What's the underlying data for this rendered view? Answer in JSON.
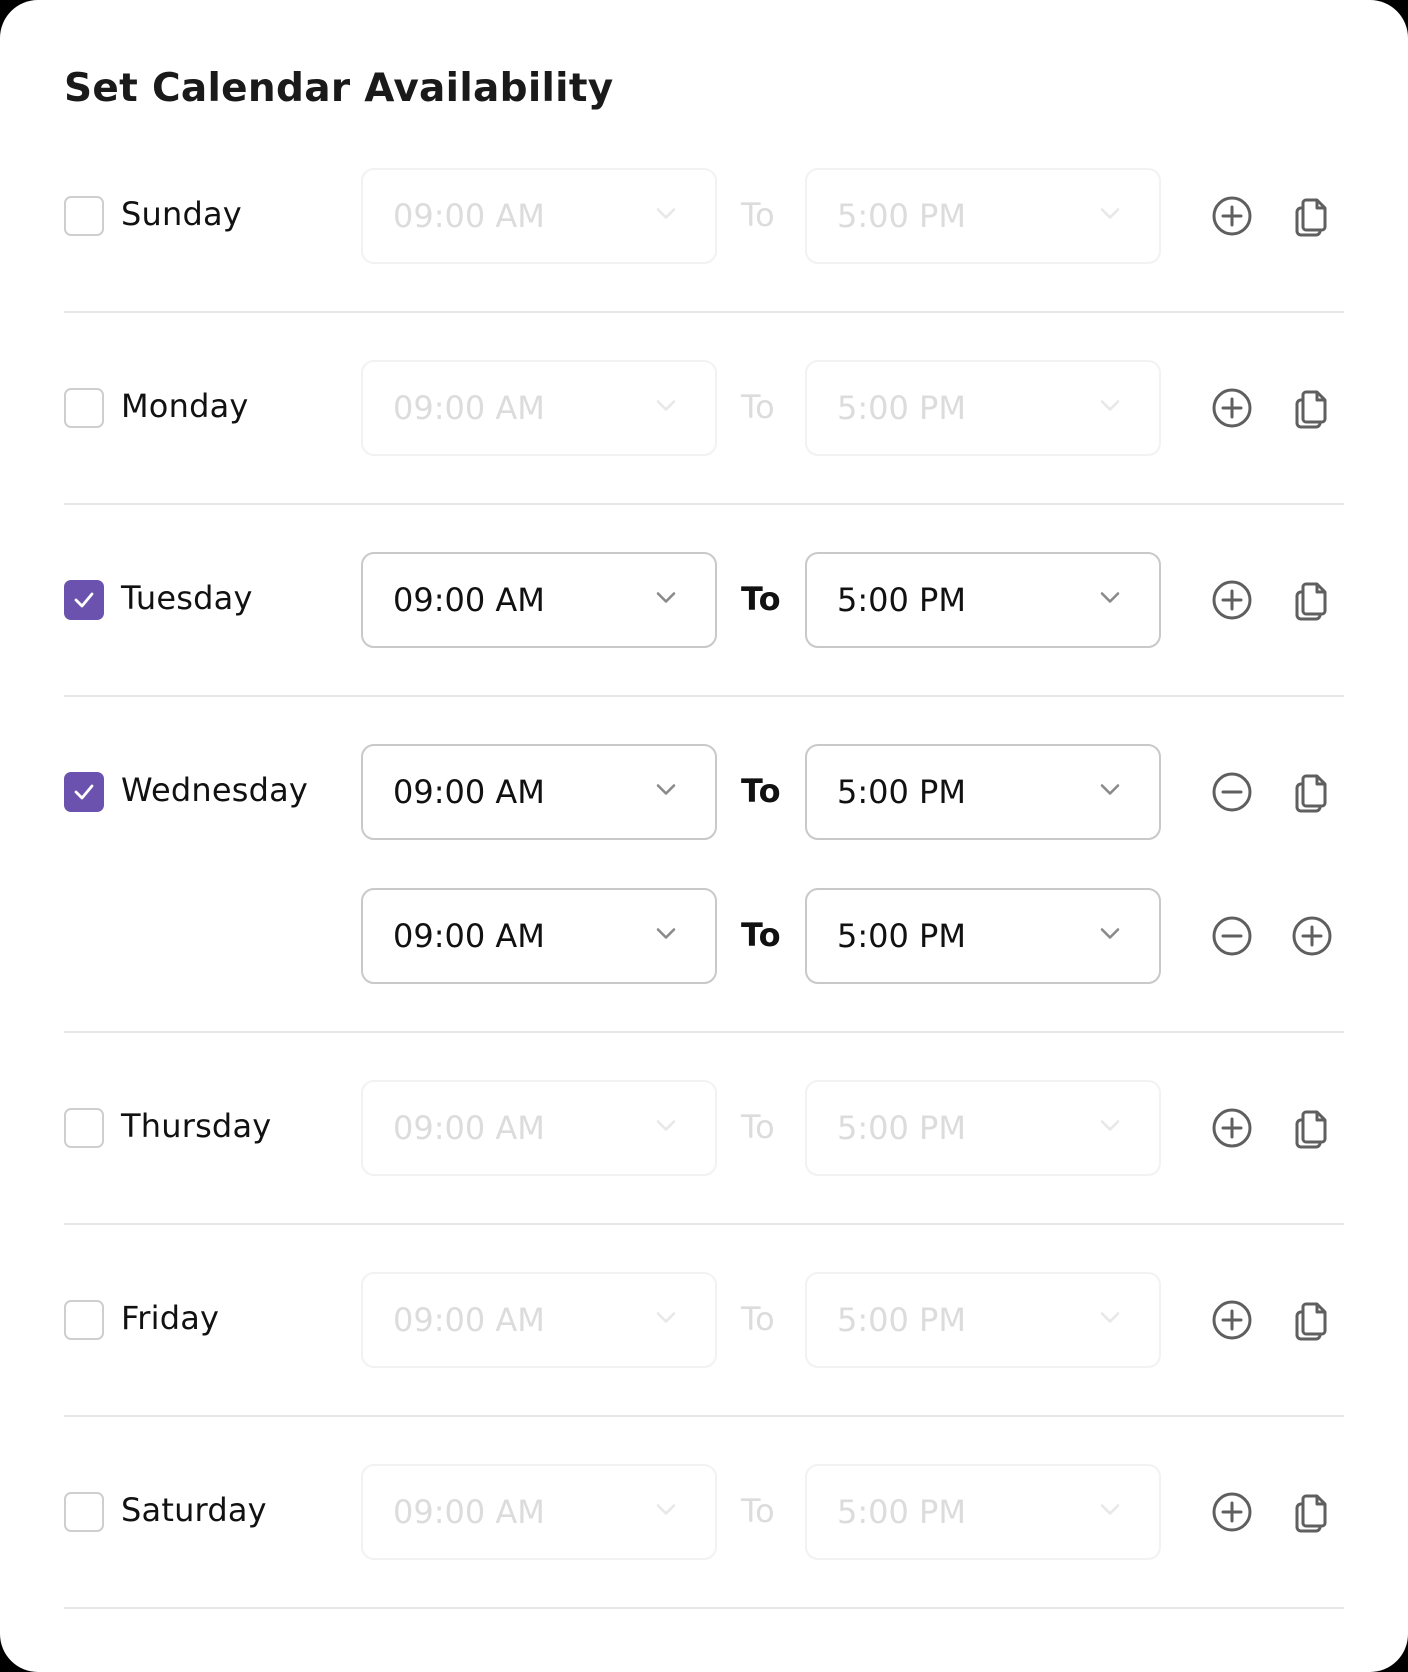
{
  "title": "Set Calendar Availability",
  "to_label": "To",
  "colors": {
    "accent": "#6b52ae",
    "icon": "#5f5f5f",
    "separator": "#e6e6e6",
    "disabled_text": "#dcdcdc"
  },
  "days": [
    {
      "name": "Sunday",
      "checked": false,
      "slots": [
        {
          "start": "09:00 AM",
          "end": "5:00 PM",
          "actions": [
            "add-icon",
            "copy-icon"
          ]
        }
      ]
    },
    {
      "name": "Monday",
      "checked": false,
      "slots": [
        {
          "start": "09:00 AM",
          "end": "5:00 PM",
          "actions": [
            "add-icon",
            "copy-icon"
          ]
        }
      ]
    },
    {
      "name": "Tuesday",
      "checked": true,
      "slots": [
        {
          "start": "09:00 AM",
          "end": "5:00 PM",
          "actions": [
            "add-icon",
            "copy-icon"
          ]
        }
      ]
    },
    {
      "name": "Wednesday",
      "checked": true,
      "slots": [
        {
          "start": "09:00 AM",
          "end": "5:00 PM",
          "actions": [
            "remove-icon",
            "copy-icon"
          ]
        },
        {
          "start": "09:00 AM",
          "end": "5:00 PM",
          "actions": [
            "remove-icon",
            "add-icon"
          ]
        }
      ]
    },
    {
      "name": "Thursday",
      "checked": false,
      "slots": [
        {
          "start": "09:00 AM",
          "end": "5:00 PM",
          "actions": [
            "add-icon",
            "copy-icon"
          ]
        }
      ]
    },
    {
      "name": "Friday",
      "checked": false,
      "slots": [
        {
          "start": "09:00 AM",
          "end": "5:00 PM",
          "actions": [
            "add-icon",
            "copy-icon"
          ]
        }
      ]
    },
    {
      "name": "Saturday",
      "checked": false,
      "slots": [
        {
          "start": "09:00 AM",
          "end": "5:00 PM",
          "actions": [
            "add-icon",
            "copy-icon"
          ]
        }
      ]
    }
  ]
}
